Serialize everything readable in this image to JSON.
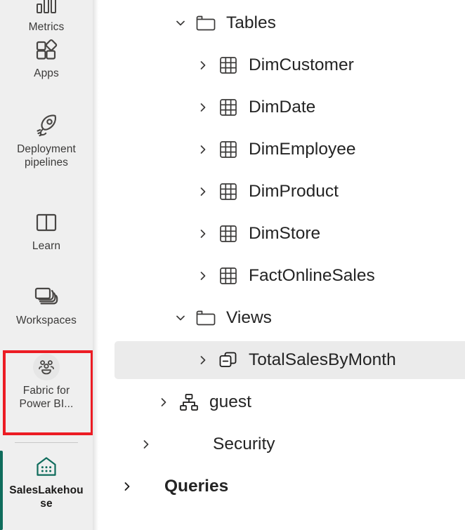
{
  "nav": {
    "items": [
      {
        "label": "Metrics",
        "icon": "metrics-icon",
        "state": "label-only"
      },
      {
        "label": "Apps",
        "icon": "apps-icon",
        "state": "normal"
      },
      {
        "label": "Deployment pipelines",
        "icon": "rocket-icon",
        "state": "normal"
      },
      {
        "label": "Learn",
        "icon": "book-icon",
        "state": "normal"
      },
      {
        "label": "Workspaces",
        "icon": "workspaces-icon",
        "state": "normal"
      },
      {
        "label": "Fabric for Power BI...",
        "icon": "people-group-icon",
        "state": "annotated"
      },
      {
        "label": "SalesLakehouse",
        "icon": "lakehouse-icon",
        "state": "selected"
      }
    ],
    "annotation": {
      "color": "#ec1c24",
      "target": "Fabric for Power BI..."
    },
    "selected_accent_color": "#0f6c5c"
  },
  "tree": {
    "selected_item": "TotalSalesByMonth",
    "rows": [
      {
        "label": "Tables",
        "icon": "folder-icon",
        "chevron": "chevron-down",
        "expanded": true,
        "indent": 2,
        "bold": false,
        "selected": false
      },
      {
        "label": "DimCustomer",
        "icon": "table-icon",
        "chevron": "chevron-right",
        "expanded": false,
        "indent": 3,
        "bold": false,
        "selected": false
      },
      {
        "label": "DimDate",
        "icon": "table-icon",
        "chevron": "chevron-right",
        "expanded": false,
        "indent": 3,
        "bold": false,
        "selected": false
      },
      {
        "label": "DimEmployee",
        "icon": "table-icon",
        "chevron": "chevron-right",
        "expanded": false,
        "indent": 3,
        "bold": false,
        "selected": false
      },
      {
        "label": "DimProduct",
        "icon": "table-icon",
        "chevron": "chevron-right",
        "expanded": false,
        "indent": 3,
        "bold": false,
        "selected": false
      },
      {
        "label": "DimStore",
        "icon": "table-icon",
        "chevron": "chevron-right",
        "expanded": false,
        "indent": 3,
        "bold": false,
        "selected": false
      },
      {
        "label": "FactOnlineSales",
        "icon": "table-icon",
        "chevron": "chevron-right",
        "expanded": false,
        "indent": 3,
        "bold": false,
        "selected": false
      },
      {
        "label": "Views",
        "icon": "folder-icon",
        "chevron": "chevron-down",
        "expanded": true,
        "indent": 2,
        "bold": false,
        "selected": false
      },
      {
        "label": "TotalSalesByMonth",
        "icon": "view-icon",
        "chevron": "chevron-right",
        "expanded": false,
        "indent": 3,
        "bold": false,
        "selected": true
      },
      {
        "label": "guest",
        "icon": "schema-icon",
        "chevron": "chevron-right",
        "expanded": false,
        "indent": 2,
        "bold": false,
        "selected": false
      },
      {
        "label": "Security",
        "icon": "none",
        "chevron": "chevron-right",
        "expanded": false,
        "indent": 1,
        "bold": false,
        "selected": false
      },
      {
        "label": "Queries",
        "icon": "none",
        "chevron": "chevron-right",
        "expanded": false,
        "indent": 0,
        "bold": true,
        "selected": false
      }
    ]
  }
}
